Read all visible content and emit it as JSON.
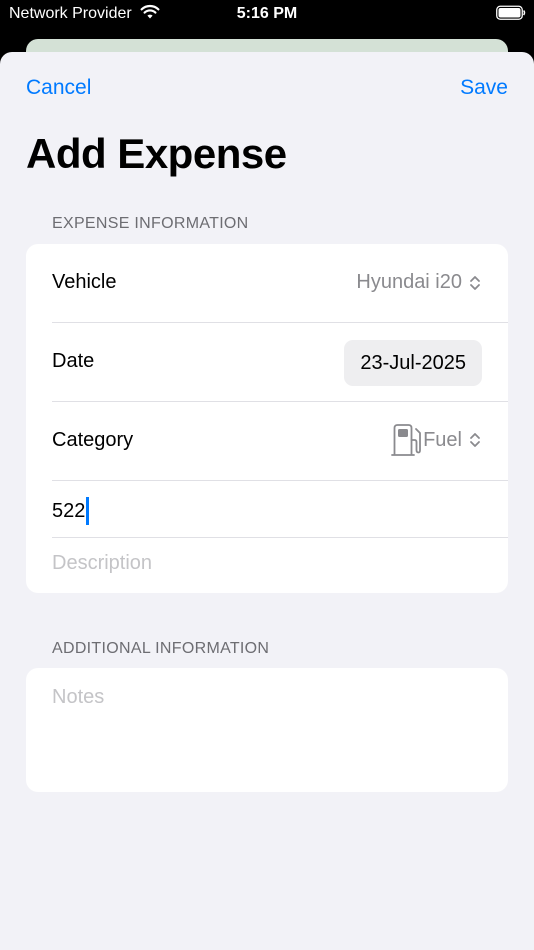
{
  "status_bar": {
    "carrier": "Network Provider",
    "time": "5:16 PM"
  },
  "nav": {
    "cancel_label": "Cancel",
    "save_label": "Save"
  },
  "title": "Add Expense",
  "expense_section": {
    "header": "EXPENSE INFORMATION",
    "vehicle_label": "Vehicle",
    "vehicle_value": "Hyundai i20",
    "date_label": "Date",
    "date_value": "23-Jul-2025",
    "category_label": "Category",
    "category_value": "Fuel",
    "category_icon": "fuel-pump-icon",
    "amount_value": "522",
    "description_placeholder": "Description"
  },
  "additional_section": {
    "header": "ADDITIONAL INFORMATION",
    "notes_placeholder": "Notes"
  },
  "colors": {
    "accent": "#007aff",
    "background": "#f2f2f7",
    "card": "#ffffff",
    "secondary_text": "#8a8a8e",
    "placeholder": "#c4c4c7"
  }
}
